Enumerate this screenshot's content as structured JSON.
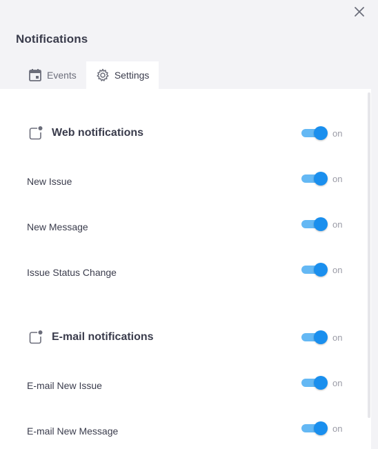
{
  "header": {
    "title": "Notifications"
  },
  "tabs": [
    {
      "label": "Events",
      "icon": "calendar-icon"
    },
    {
      "label": "Settings",
      "icon": "gear-icon",
      "active": true
    }
  ],
  "web_section": {
    "title": "Web notifications",
    "icon": "notification-badge-icon",
    "enabled": true,
    "state_label": "on",
    "items": [
      {
        "label": "New Issue",
        "enabled": true,
        "state_label": "on"
      },
      {
        "label": "New Message",
        "enabled": true,
        "state_label": "on"
      },
      {
        "label": "Issue Status Change",
        "enabled": true,
        "state_label": "on"
      }
    ]
  },
  "email_section": {
    "title": "E-mail notifications",
    "icon": "notification-badge-icon",
    "enabled": true,
    "state_label": "on",
    "items": [
      {
        "label": "E-mail New Issue",
        "enabled": true,
        "state_label": "on"
      },
      {
        "label": "E-mail New Message",
        "enabled": true,
        "state_label": "on"
      }
    ]
  },
  "colors": {
    "accent": "#1a8fee",
    "track": "#64b8f4",
    "icon": "#6b6d7a"
  }
}
